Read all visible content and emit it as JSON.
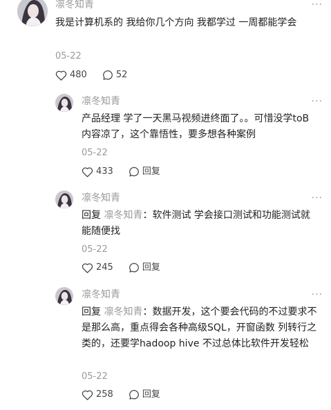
{
  "top_comment": {
    "username": "凛冬知青",
    "text": "我是计算机系的 我给你几个方向 我都学过 一周都能学会",
    "date": "05-22",
    "likes": "480",
    "replies_count": "52",
    "more_label": "···"
  },
  "replies": [
    {
      "username": "凛冬知青",
      "prefix": "",
      "target": "",
      "text": "产品经理 学了一天黑马视频进终面了。。可惜没学toB内容凉了，这个靠悟性，要多想各种案例",
      "date": "05-22",
      "likes": "433",
      "reply_label": "回复",
      "more_label": "···"
    },
    {
      "username": "凛冬知青",
      "prefix": "回复",
      "target": "凛冬知青",
      "text": "：软件测试 学会接口测试和功能测试就能随便找",
      "date": "05-22",
      "likes": "245",
      "reply_label": "回复",
      "more_label": "···"
    },
    {
      "username": "凛冬知青",
      "prefix": "回复",
      "target": "凛冬知青",
      "text": "：数据开发，这个要会代码的不过要求不是那么高，重点得会各种高级SQL，开窗函数 列转行之类的，还要学hadoop hive 不过总体比软件开发轻松",
      "date": "05-22",
      "likes": "258",
      "reply_label": "回复",
      "more_label": "···"
    }
  ]
}
